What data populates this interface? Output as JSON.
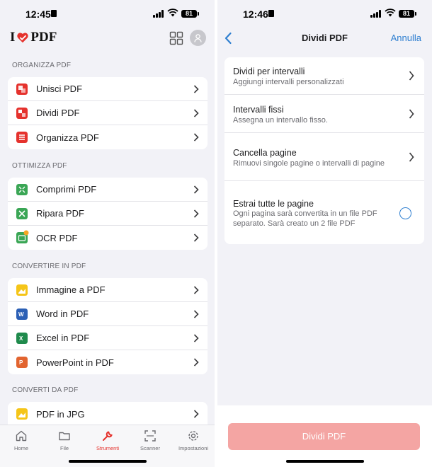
{
  "left": {
    "status": {
      "time": "12:45",
      "battery": "81"
    },
    "logo": {
      "before": "I",
      "after": "PDF"
    },
    "sections": [
      {
        "title": "ORGANIZZA PDF",
        "items": [
          {
            "label": "Unisci PDF",
            "icon": "merge-icon"
          },
          {
            "label": "Dividi PDF",
            "icon": "split-icon"
          },
          {
            "label": "Organizza PDF",
            "icon": "organize-icon"
          }
        ]
      },
      {
        "title": "OTTIMIZZA PDF",
        "items": [
          {
            "label": "Comprimi PDF",
            "icon": "compress-icon"
          },
          {
            "label": "Ripara PDF",
            "icon": "repair-icon"
          },
          {
            "label": "OCR PDF",
            "icon": "ocr-icon"
          }
        ]
      },
      {
        "title": "CONVERTIRE IN PDF",
        "items": [
          {
            "label": "Immagine a PDF",
            "icon": "image-icon"
          },
          {
            "label": "Word in PDF",
            "icon": "word-icon"
          },
          {
            "label": "Excel in PDF",
            "icon": "excel-icon"
          },
          {
            "label": "PowerPoint in PDF",
            "icon": "powerpoint-icon"
          }
        ]
      },
      {
        "title": "CONVERTI DA PDF",
        "items": [
          {
            "label": "PDF in JPG",
            "icon": "jpg-icon"
          }
        ]
      }
    ],
    "tabs": [
      {
        "label": "Home",
        "icon": "home-icon"
      },
      {
        "label": "File",
        "icon": "folder-icon"
      },
      {
        "label": "Strumenti",
        "icon": "wrench-icon",
        "active": true
      },
      {
        "label": "Scanner",
        "icon": "scanner-icon"
      },
      {
        "label": "Impostazioni",
        "icon": "gear-icon"
      }
    ]
  },
  "right": {
    "status": {
      "time": "12:46",
      "battery": "81"
    },
    "nav": {
      "title": "Dividi PDF",
      "cancel": "Annulla"
    },
    "options": [
      {
        "title": "Dividi per intervalli",
        "subtitle": "Aggiungi intervalli personalizzati",
        "control": "chevron"
      },
      {
        "title": "Intervalli fissi",
        "subtitle": "Assegna un intervallo fisso.",
        "control": "chevron"
      },
      {
        "title": "Cancella pagine",
        "subtitle": "Rimuovi singole pagine o intervalli di pagine",
        "control": "chevron"
      },
      {
        "title": "Estrai tutte le pagine",
        "subtitle": "Ogni pagina sarà convertita in un file PDF separato. Sarà creato un 2 file PDF",
        "control": "radio"
      }
    ],
    "primary_button": "Dividi PDF"
  },
  "colors": {
    "brand_red": "#e5322d",
    "ios_blue": "#2f7fd0",
    "disabled_button": "#f4a5a3"
  }
}
